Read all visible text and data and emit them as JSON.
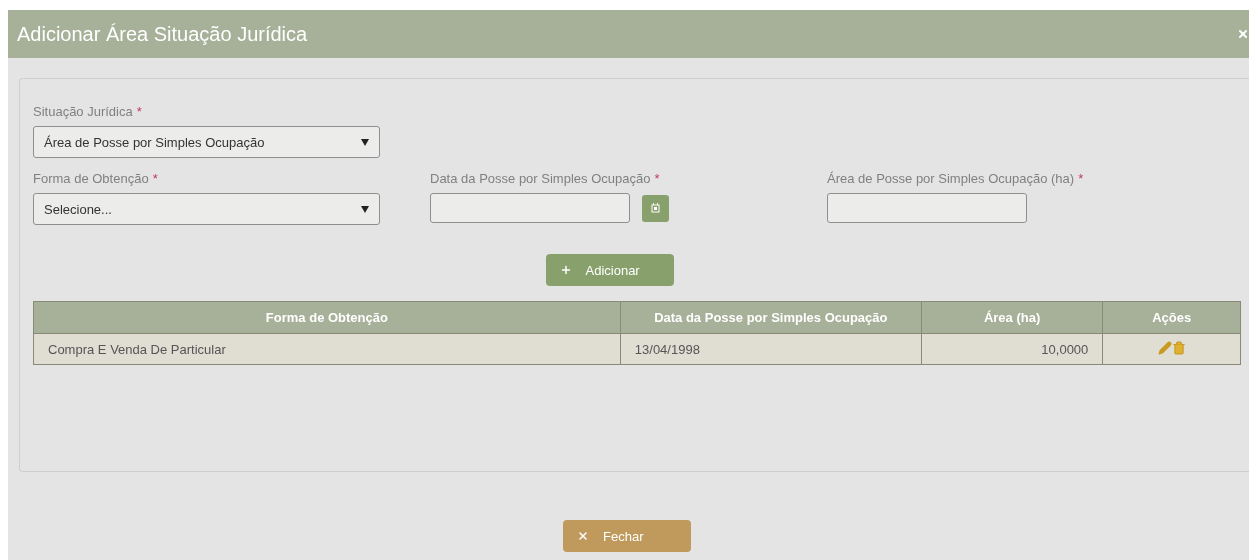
{
  "dialog": {
    "title": "Adicionar Área Situação Jurídica"
  },
  "fields": [
    {
      "kind": "select",
      "label": "Situação Jurídica",
      "required_mark": "*",
      "value": "Área de Posse por Simples Ocupação"
    },
    {
      "kind": "select",
      "label": "Forma de Obtenção",
      "required_mark": "*",
      "value": "Selecione..."
    },
    {
      "kind": "date",
      "label": "Data da Posse por Simples Ocupação",
      "required_mark": "*"
    },
    {
      "kind": "text",
      "label": "Área de Posse por Simples Ocupação (ha)",
      "required_mark": "*"
    }
  ],
  "add_button": {
    "label": "Adicionar"
  },
  "table": {
    "columns": [
      {
        "label": "Forma de Obtenção"
      },
      {
        "label": "Data da Posse por Simples Ocupação"
      },
      {
        "label": "Área (ha)"
      },
      {
        "label": "Ações"
      }
    ],
    "rows": [
      {
        "cells": [
          "Compra E Venda De Particular",
          "13/04/1998",
          "10,0000"
        ]
      }
    ]
  },
  "close_button": {
    "label": "Fechar"
  }
}
